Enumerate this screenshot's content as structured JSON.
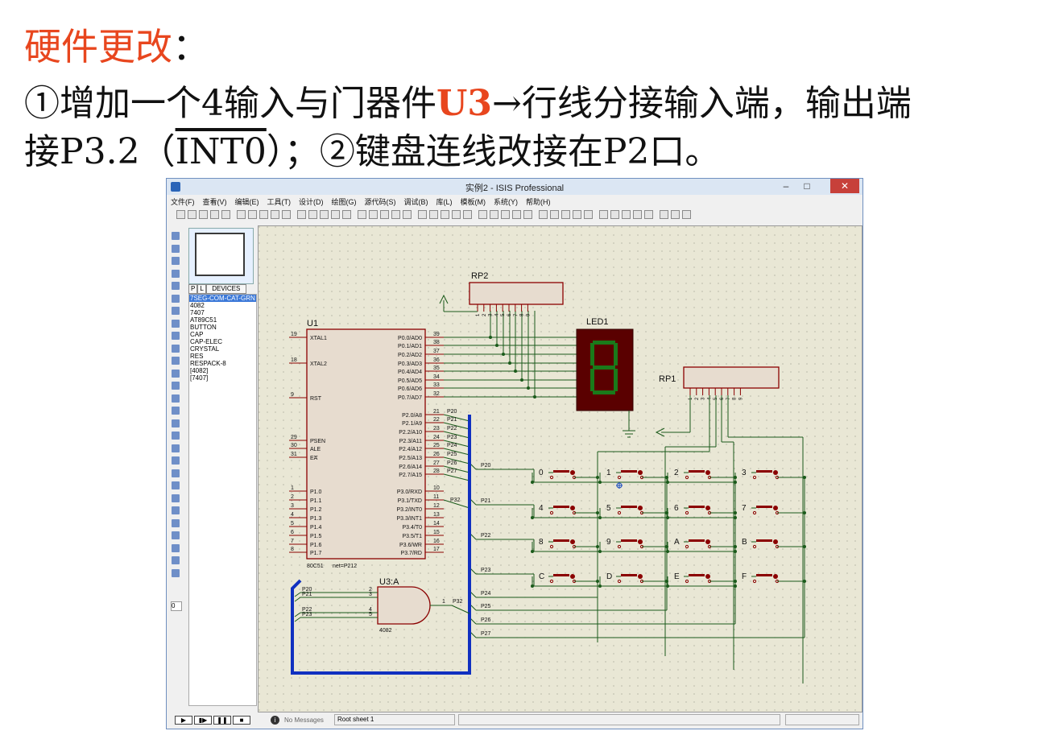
{
  "slide": {
    "title": "硬件更改",
    "title_colon": "：",
    "l1_a": "①增加一个4输入与门器件",
    "l1_u3": "U3",
    "l1_b": "→行线分接输入端，输出端",
    "l2_a": "接P3.2（",
    "l2_int0": "INT0",
    "l2_b": "）；②键盘连线改接在P2口。"
  },
  "window": {
    "title": "实例2 - ISIS Professional",
    "min": "–",
    "max": "□",
    "close": "✕",
    "menus": [
      "文件(F)",
      "查看(V)",
      "编辑(E)",
      "工具(T)",
      "设计(D)",
      "绘图(G)",
      "源代码(S)",
      "调试(B)",
      "库(L)",
      "模板(M)",
      "系统(Y)",
      "帮助(H)"
    ]
  },
  "device_panel": {
    "tab_p": "P",
    "tab_l": "L",
    "header": "DEVICES",
    "items": [
      "7SEG-COM-CAT-GRN",
      "4082",
      "7407",
      "AT89C51",
      "BUTTON",
      "CAP",
      "CAP-ELEC",
      "CRYSTAL",
      "RES",
      "RESPACK-8",
      "[4082]",
      "[7407]"
    ]
  },
  "left_field": "0",
  "status": {
    "messages": "No Messages",
    "sheet": "Root sheet 1",
    "play": "▶",
    "step": "▮▶",
    "pause": "❚❚",
    "stop": "■"
  },
  "schematic": {
    "u1_ref": "U1",
    "u1_type": "80C51",
    "u1_net": "net=P212",
    "u1_left_pins": [
      {
        "num": "19",
        "name": "XTAL1"
      },
      {
        "num": "18",
        "name": "XTAL2"
      },
      {
        "num": "9",
        "name": "RST"
      },
      {
        "num": "29",
        "name": "PSEN"
      },
      {
        "num": "30",
        "name": "ALE"
      },
      {
        "num": "31",
        "name": "EA"
      },
      {
        "num": "1",
        "name": "P1.0"
      },
      {
        "num": "2",
        "name": "P1.1"
      },
      {
        "num": "3",
        "name": "P1.2"
      },
      {
        "num": "4",
        "name": "P1.3"
      },
      {
        "num": "5",
        "name": "P1.4"
      },
      {
        "num": "6",
        "name": "P1.5"
      },
      {
        "num": "7",
        "name": "P1.6"
      },
      {
        "num": "8",
        "name": "P1.7"
      }
    ],
    "u1_right_pins": [
      {
        "num": "39",
        "name": "P0.0/AD0"
      },
      {
        "num": "38",
        "name": "P0.1/AD1"
      },
      {
        "num": "37",
        "name": "P0.2/AD2"
      },
      {
        "num": "36",
        "name": "P0.3/AD3"
      },
      {
        "num": "35",
        "name": "P0.4/AD4"
      },
      {
        "num": "34",
        "name": "P0.5/AD5"
      },
      {
        "num": "33",
        "name": "P0.6/AD6"
      },
      {
        "num": "32",
        "name": "P0.7/AD7"
      },
      {
        "num": "21",
        "name": "P2.0/A8",
        "net": "P20"
      },
      {
        "num": "22",
        "name": "P2.1/A9",
        "net": "P21"
      },
      {
        "num": "23",
        "name": "P2.2/A10",
        "net": "P22"
      },
      {
        "num": "24",
        "name": "P2.3/A11",
        "net": "P23"
      },
      {
        "num": "25",
        "name": "P2.4/A12",
        "net": "P24"
      },
      {
        "num": "26",
        "name": "P2.5/A13",
        "net": "P25"
      },
      {
        "num": "27",
        "name": "P2.6/A14",
        "net": "P26"
      },
      {
        "num": "28",
        "name": "P2.7/A15",
        "net": "P27"
      },
      {
        "num": "10",
        "name": "P3.0/RXD"
      },
      {
        "num": "11",
        "name": "P3.1/TXD"
      },
      {
        "num": "12",
        "name": "P3.2/INT0",
        "net": "P32"
      },
      {
        "num": "13",
        "name": "P3.3/INT1"
      },
      {
        "num": "14",
        "name": "P3.4/T0"
      },
      {
        "num": "15",
        "name": "P3.5/T1"
      },
      {
        "num": "16",
        "name": "P3.6/WR"
      },
      {
        "num": "17",
        "name": "P3.7/RD"
      }
    ],
    "rp2_ref": "RP2",
    "rp1_ref": "RP1",
    "rp_pins": [
      "1",
      "2",
      "3",
      "4",
      "5",
      "6",
      "7",
      "8",
      "9"
    ],
    "led_ref": "LED1",
    "led_digit": "8",
    "u3_ref": "U3:A",
    "u3_type": "4082",
    "u3_inputs": [
      {
        "net": "P20",
        "num": "2"
      },
      {
        "net": "P21",
        "num": "3"
      },
      {
        "net": "P22",
        "num": "4"
      },
      {
        "net": "P23",
        "num": "5"
      }
    ],
    "u3_out_num": "1",
    "u3_out_net": "P32",
    "row_nets": [
      "P20",
      "P21",
      "P22",
      "P23"
    ],
    "col_nets": [
      "P24",
      "P25",
      "P26",
      "P27"
    ],
    "keys": [
      "0",
      "1",
      "2",
      "3",
      "4",
      "5",
      "6",
      "7",
      "8",
      "9",
      "A",
      "B",
      "C",
      "D",
      "E",
      "F"
    ],
    "colors": {
      "wire": "#1a5a1a",
      "bus": "#1030c0",
      "body": "#8b0000",
      "body_fill": "#e7dccf",
      "canvas": "#e9e7d5",
      "led_bg": "#5a0000",
      "led_seg": "#1a7a1a"
    }
  }
}
